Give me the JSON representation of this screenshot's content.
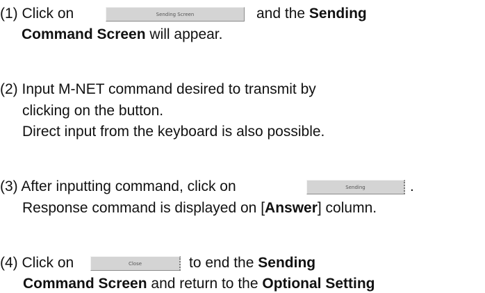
{
  "step1": {
    "num": "(1) Click on",
    "button_label": "Sending Screen",
    "after": "and the",
    "bold1": "Sending",
    "line2_bold": "Command Screen",
    "line2_rest": "will appear."
  },
  "step2": {
    "line1": "(2) Input M-NET command desired to transmit by",
    "line2": "clicking on the button.",
    "line3": "Direct input from the keyboard is also possible."
  },
  "step3": {
    "line1_text": "(3) After inputting command, click on",
    "button_label": "Sending",
    "period": ".",
    "line2_pre": "Response command is displayed on [",
    "line2_bold": "Answer",
    "line2_post": "] column."
  },
  "step4": {
    "num": "(4) Click on",
    "button_label": "Close",
    "after": "to end the",
    "bold1": "Sending",
    "line2_bold1": "Command Screen",
    "line2_mid": "and return to the",
    "line2_bold2": "Optional Setting"
  }
}
